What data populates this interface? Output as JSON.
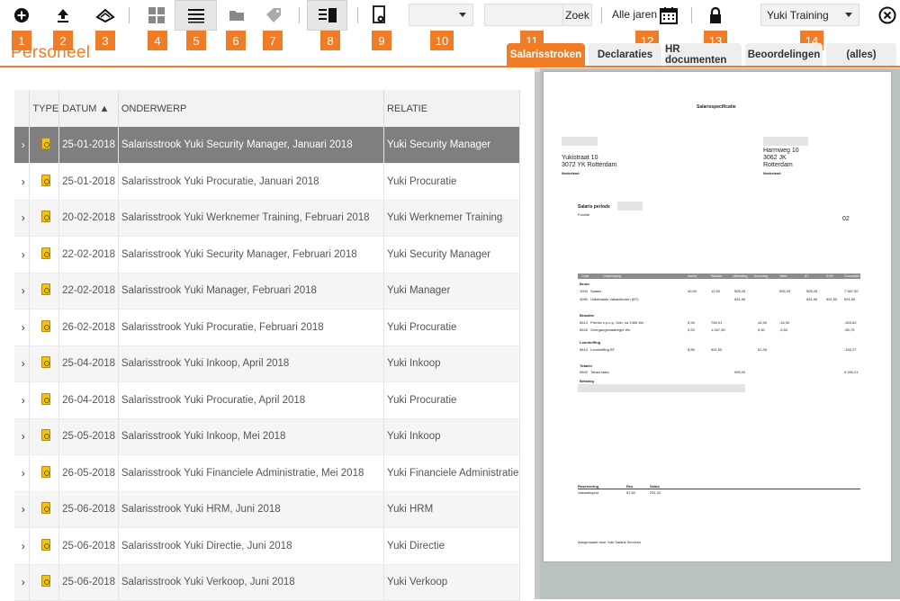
{
  "toolbar": {
    "search_button": "Zoek",
    "years_label": "Alle jaren",
    "type_select_value": "",
    "domain_select_value": "Yuki Training"
  },
  "badges": [
    "1",
    "2",
    "3",
    "4",
    "5",
    "6",
    "7",
    "8",
    "9",
    "10",
    "11",
    "12",
    "13",
    "14"
  ],
  "page_title": "Personeel",
  "tabs": [
    {
      "label": "Salarisstroken",
      "active": true
    },
    {
      "label": "Declaraties"
    },
    {
      "label": "HR documenten"
    },
    {
      "label": "Beoordelingen"
    },
    {
      "label": "(alles)"
    }
  ],
  "table": {
    "headers": {
      "type": "TYPE",
      "datum": "DATUM ▲",
      "onderwerp": "ONDERWERP",
      "relatie": "RELATIE"
    },
    "rows": [
      {
        "datum": "25-01-2018",
        "onderwerp": "Salarisstrook Yuki Security Manager, Januari 2018",
        "relatie": "Yuki Security Manager"
      },
      {
        "datum": "25-01-2018",
        "onderwerp": "Salarisstrook Yuki Procuratie, Januari 2018",
        "relatie": "Yuki Procuratie"
      },
      {
        "datum": "20-02-2018",
        "onderwerp": "Salarisstrook Yuki Werknemer Training, Februari 2018",
        "relatie": "Yuki Werknemer Training"
      },
      {
        "datum": "22-02-2018",
        "onderwerp": "Salarisstrook Yuki Security Manager, Februari 2018",
        "relatie": "Yuki Security Manager"
      },
      {
        "datum": "22-02-2018",
        "onderwerp": "Salarisstrook Yuki Manager, Februari 2018",
        "relatie": "Yuki Manager"
      },
      {
        "datum": "26-02-2018",
        "onderwerp": "Salarisstrook Yuki Procuratie, Februari 2018",
        "relatie": "Yuki Procuratie"
      },
      {
        "datum": "25-04-2018",
        "onderwerp": "Salarisstrook Yuki Inkoop, April 2018",
        "relatie": "Yuki Inkoop"
      },
      {
        "datum": "26-04-2018",
        "onderwerp": "Salarisstrook Yuki Procuratie, April 2018",
        "relatie": "Yuki Procuratie"
      },
      {
        "datum": "25-05-2018",
        "onderwerp": "Salarisstrook Yuki Inkoop, Mei 2018",
        "relatie": "Yuki Inkoop"
      },
      {
        "datum": "26-05-2018",
        "onderwerp": "Salarisstrook Yuki Financiele Administratie, Mei 2018",
        "relatie": "Yuki Financiele Administratie"
      },
      {
        "datum": "25-06-2018",
        "onderwerp": "Salarisstrook Yuki HRM, Juni 2018",
        "relatie": "Yuki HRM"
      },
      {
        "datum": "25-06-2018",
        "onderwerp": "Salarisstrook Yuki Directie, Juni 2018",
        "relatie": "Yuki Directie"
      },
      {
        "datum": "25-06-2018",
        "onderwerp": "Salarisstrook Yuki Verkoop, Juni 2018",
        "relatie": "Yuki Verkoop"
      }
    ]
  },
  "preview": {
    "title": "Salarisspecificatie",
    "sender_street": "Yukistraat 10",
    "sender_city": "3072 YK Rotterdam",
    "sender_country": "Nederland",
    "recipient_street": "Harmweg 10",
    "recipient_zip": "3062 JK",
    "recipient_city": "Rotterdam",
    "recipient_country": "Nederland",
    "period_label": "Salaris periode",
    "period_number": "02",
    "funct": "Functie",
    "footer": "Aangemaakt door Yuki Salaris Services",
    "sections": [
      "Bruto",
      "Brandhe",
      "Loonheffing",
      "Totalen",
      "Betaling"
    ],
    "col_headers": [
      "Code",
      "Omschrijving",
      "Aantal",
      "Waarde",
      "Uitbetaling",
      "Inhouding",
      "Tabel",
      "BT",
      "SVW",
      "Cumulatief"
    ],
    "lines": [
      {
        "code": "1000",
        "desc": "Salaris",
        "aantal": "40,00",
        "waarde": "12,50",
        "uit": "506,25",
        "tabel": "506,25",
        "bt": "506,25",
        "cum": "7.987,50"
      },
      {
        "code": "4050",
        "desc": "Uitbetaalde Vakantieuren (BT)",
        "uit": "591,50",
        "bt": "591,50",
        "svw": "591,50",
        "cum": "591,50"
      },
      {
        "code": "6514",
        "desc": "Premie c.p.n.p. Geb. na 1950 Wn",
        "aantal": "5,94",
        "waarde": "755,91",
        "inh": "44,90",
        "tabel": "-44,90",
        "cum": "-303,82"
      },
      {
        "code": "6516",
        "desc": "Overgangsmaatregel Wn",
        "aantal": "0,53",
        "waarde": "1.047,35",
        "inh": "5,50",
        "tabel": "-5,50",
        "cum": "-55,75"
      },
      {
        "code": "8810",
        "desc": "Loonheffing BT",
        "aantal": "8,85",
        "waarde": "591,50",
        "inh": "52,35",
        "cum": "-150,27"
      },
      {
        "code": "9800",
        "desc": "Totaal netto",
        "uit": "995,00",
        "cum": "9.290,21"
      },
      {
        "code": "9850",
        "desc": "Per bankrekening BIC",
        "uit": "995,00"
      }
    ],
    "reservering": [
      "Reservering",
      "Res",
      "Saldo",
      "Vakantiegeld",
      "87,62",
      "291,32"
    ]
  }
}
